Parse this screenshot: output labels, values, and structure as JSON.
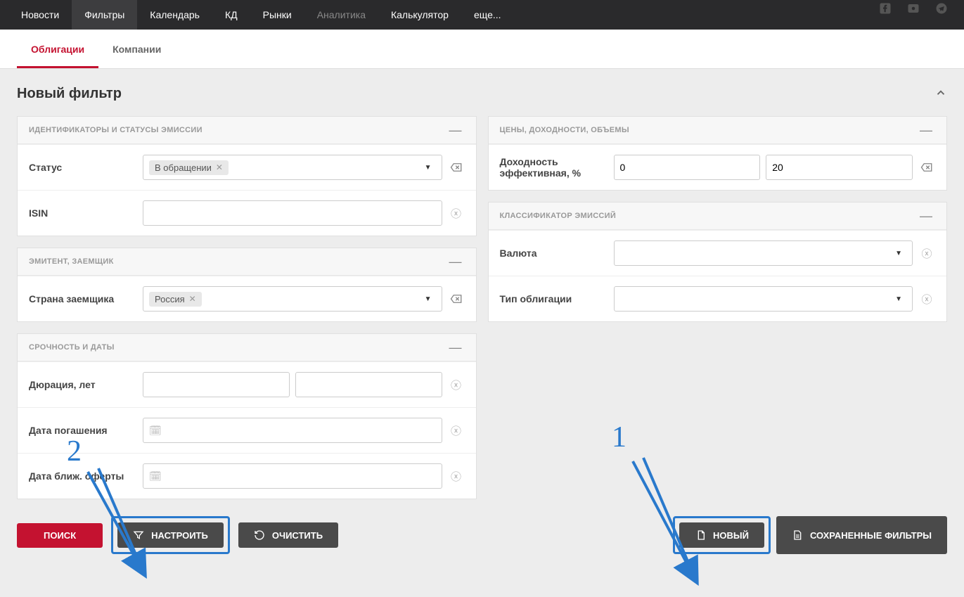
{
  "nav": {
    "items": [
      "Новости",
      "Фильтры",
      "Календарь",
      "КД",
      "Рынки",
      "Аналитика",
      "Калькулятор",
      "еще..."
    ],
    "active_index": 1,
    "muted_indices": [
      5
    ]
  },
  "subnav": {
    "tabs": [
      "Облигации",
      "Компании"
    ],
    "active_index": 0
  },
  "page_title": "Новый фильтр",
  "panels": {
    "identifiers": {
      "title": "ИДЕНТИФИКАТОРЫ И СТАТУСЫ ЭМИССИИ",
      "status_label": "Статус",
      "status_chip": "В обращении",
      "isin_label": "ISIN",
      "isin_value": ""
    },
    "issuer": {
      "title": "ЭМИТЕНТ, ЗАЕМЩИК",
      "country_label": "Страна заемщика",
      "country_chip": "Россия"
    },
    "dates": {
      "title": "СРОЧНОСТЬ И ДАТЫ",
      "duration_label": "Дюрация, лет",
      "duration_from": "",
      "duration_to": "",
      "maturity_label": "Дата погашения",
      "maturity_value": "",
      "offer_label": "Дата ближ. оферты",
      "offer_value": ""
    },
    "prices": {
      "title": "ЦЕНЫ, ДОХОДНОСТИ, ОБЪЕМЫ",
      "yield_label": "Доходность эффективная, %",
      "yield_from": "0",
      "yield_to": "20"
    },
    "classifier": {
      "title": "КЛАССИФИКАТОР ЭМИССИЙ",
      "currency_label": "Валюта",
      "bond_type_label": "Тип облигации"
    }
  },
  "footer": {
    "search": "ПОИСК",
    "configure": "НАСТРОИТЬ",
    "clear": "ОЧИСТИТЬ",
    "new": "НОВЫЙ",
    "saved": "СОХРАНЕННЫЕ ФИЛЬТРЫ"
  },
  "annotations": {
    "one": "1",
    "two": "2"
  }
}
